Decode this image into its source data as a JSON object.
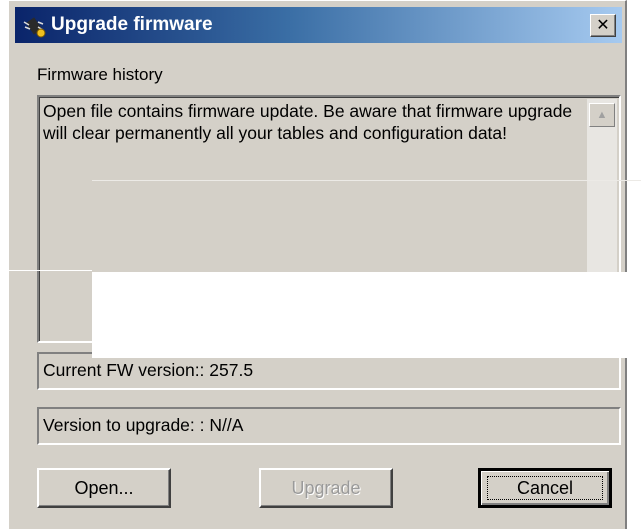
{
  "window": {
    "title": "Upgrade firmware",
    "close_symbol": "✕",
    "icon": "firmware-chip-icon"
  },
  "history": {
    "label": "Firmware history",
    "text": "Open file contains firmware update. Be aware that firmware upgrade will clear permanently all your tables and configuration data!",
    "scroll_up_symbol": "▲"
  },
  "current_version": "Current FW version:: 257.5",
  "upgrade_version": "Version to upgrade: : N//A",
  "buttons": {
    "open": "Open...",
    "upgrade": "Upgrade",
    "cancel": "Cancel"
  },
  "colors": {
    "titlebar_start": "#0a246a",
    "titlebar_end": "#a6caf0",
    "face": "#d4d0c8"
  }
}
